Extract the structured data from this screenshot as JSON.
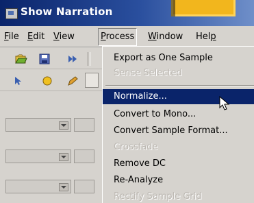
{
  "window": {
    "title": "Show Narration"
  },
  "menubar": {
    "items": [
      {
        "label": "File",
        "u": "F"
      },
      {
        "label": "Edit",
        "u": "E"
      },
      {
        "label": "View",
        "u": "V"
      },
      {
        "label": "Process",
        "u": "P"
      },
      {
        "label": "Window",
        "u": "W"
      },
      {
        "label": "Help",
        "u": "H"
      }
    ],
    "active": "Process"
  },
  "process_menu": {
    "items": [
      {
        "label": "Export as One Sample",
        "enabled": true
      },
      {
        "label": "Sense Selected",
        "enabled": false
      },
      {
        "label": "Normalize...",
        "enabled": true,
        "selected": true
      },
      {
        "label": "Convert to Mono...",
        "enabled": true
      },
      {
        "label": "Convert Sample Format...",
        "enabled": true
      },
      {
        "label": "Crossfade",
        "enabled": false
      },
      {
        "label": "Remove DC",
        "enabled": true
      },
      {
        "label": "Re-Analyze",
        "enabled": true
      },
      {
        "label": "Rectify Sample Grid",
        "enabled": false
      }
    ]
  },
  "colors": {
    "titlebar": "#0a246a",
    "selection": "#0a246a",
    "badge": "#f2b61d",
    "menu_bg": "#d6d3ce"
  }
}
